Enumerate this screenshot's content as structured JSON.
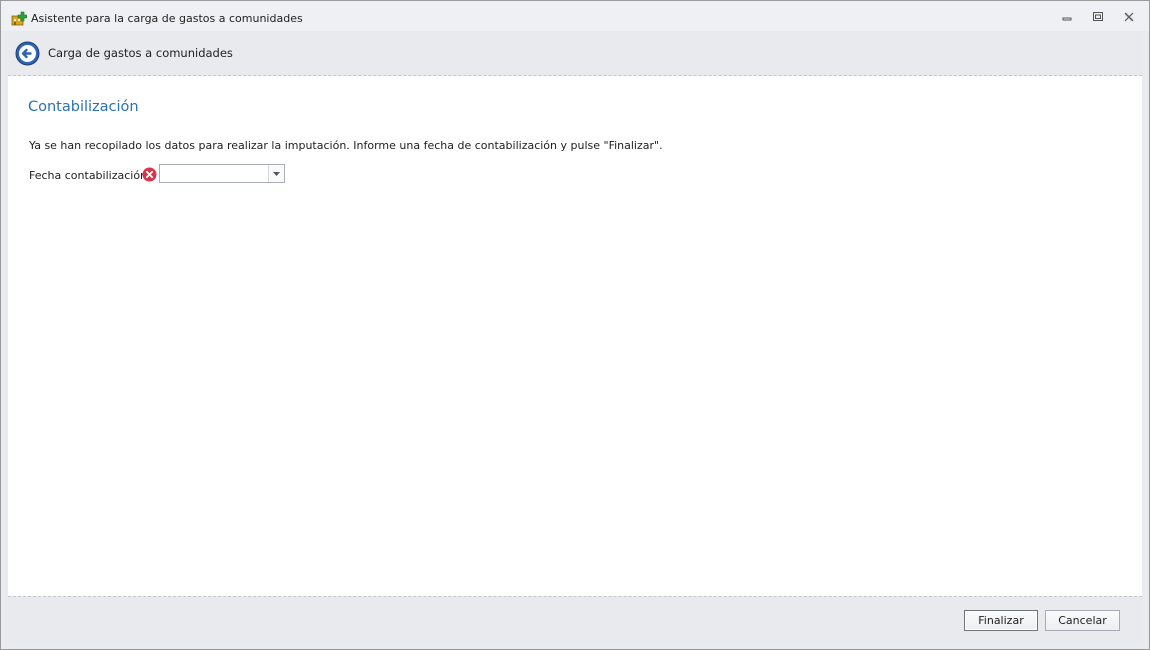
{
  "window": {
    "title": "Asistente para la carga de gastos a comunidades",
    "icon": "app-house-icon"
  },
  "header": {
    "title": "Carga de gastos a comunidades",
    "back_icon": "back-arrow-icon"
  },
  "page": {
    "title": "Contabilización",
    "instruction": "Ya se han recopilado los datos para realizar la imputación. Informe una fecha de contabilización y pulse \"Finalizar\".",
    "fecha_label": "Fecha contabilización:",
    "fecha_value": "",
    "fecha_error_icon": "error-icon"
  },
  "footer": {
    "finish_label": "Finalizar",
    "cancel_label": "Cancelar"
  },
  "colors": {
    "title_accent": "#2a72b0",
    "error": "#d8344a",
    "back_button": "#2f63b5"
  }
}
